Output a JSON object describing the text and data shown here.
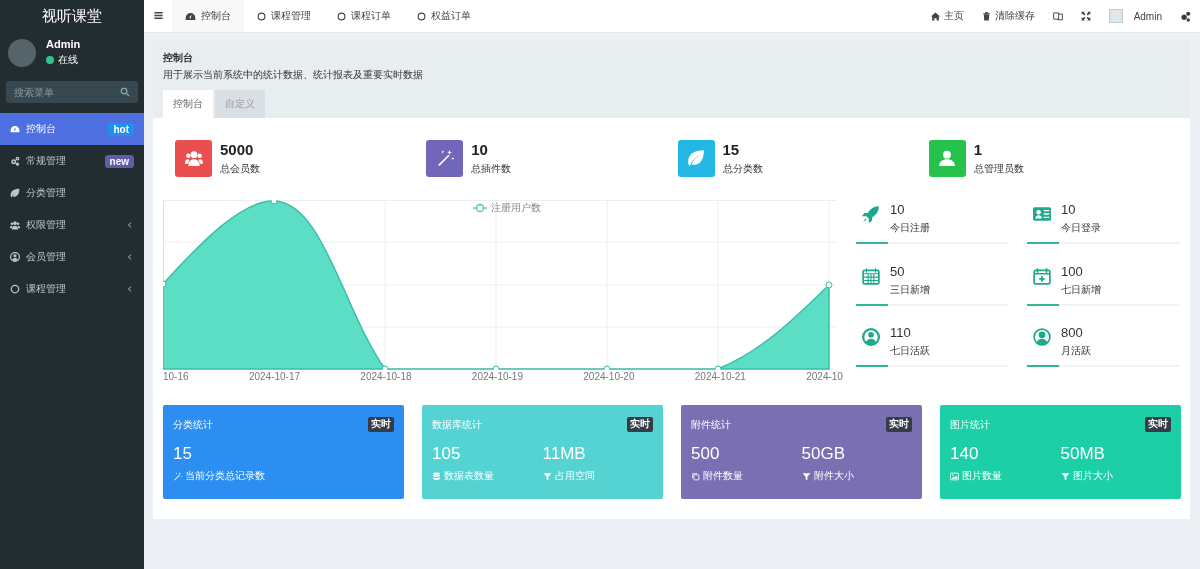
{
  "sidebar": {
    "logo": "视听课堂",
    "user": {
      "name": "Admin",
      "status": "在线"
    },
    "search": {
      "placeholder": "搜索菜单"
    },
    "items": [
      {
        "label": "控制台",
        "selected": true,
        "has_children": false,
        "badge": {
          "text": "hot",
          "color": "#1e90f0"
        }
      },
      {
        "label": "常规管理",
        "selected": false,
        "has_children": false,
        "badge": {
          "text": "new",
          "color": "#605ca8"
        }
      },
      {
        "label": "分类管理",
        "selected": false,
        "has_children": false
      },
      {
        "label": "权限管理",
        "selected": false,
        "has_children": true
      },
      {
        "label": "会员管理",
        "selected": false,
        "has_children": true
      },
      {
        "label": "课程管理",
        "selected": false,
        "has_children": true
      }
    ]
  },
  "topbar": {
    "tabs": [
      {
        "label": "控制台",
        "selected": true
      },
      {
        "label": "课程管理",
        "selected": false
      },
      {
        "label": "课程订单",
        "selected": false
      },
      {
        "label": "权益订单",
        "selected": false
      }
    ],
    "links": [
      "主页",
      "清除缓存"
    ],
    "user": "Admin"
  },
  "panel": {
    "title": "控制台",
    "description": "用于展示当前系统中的统计数据、统计报表及重要实时数据",
    "tabs": [
      {
        "label": "控制台",
        "selected": true
      },
      {
        "label": "自定义",
        "selected": false
      }
    ],
    "stats": [
      {
        "value": "5000",
        "label": "总会员数",
        "color": "#e94f4f"
      },
      {
        "value": "10",
        "label": "总插件数",
        "color": "#7266ba"
      },
      {
        "value": "15",
        "label": "总分类数",
        "color": "#23b7e5"
      },
      {
        "value": "1",
        "label": "总管理员数",
        "color": "#27c24c"
      }
    ],
    "chart": {
      "legend": "注册用户数",
      "x_labels": [
        "10-16",
        "2024-10-17",
        "2024-10-18",
        "2024-10-19",
        "2024-10-20",
        "2024-10-21",
        "2024-10"
      ]
    },
    "mini_stats": [
      {
        "value": "10",
        "label": "今日注册"
      },
      {
        "value": "10",
        "label": "今日登录"
      },
      {
        "value": "50",
        "label": "三日新增"
      },
      {
        "value": "100",
        "label": "七日新增"
      },
      {
        "value": "110",
        "label": "七日活跃"
      },
      {
        "value": "800",
        "label": "月活跃"
      }
    ],
    "cards": [
      {
        "title": "分类统计",
        "badge": "实时",
        "color": "#2b8ef0",
        "metrics": [
          {
            "value": "15",
            "label": "当前分类总记录数"
          }
        ]
      },
      {
        "title": "数据库统计",
        "badge": "实时",
        "color": "#55d3d3",
        "metrics": [
          {
            "value": "105",
            "label": "数据表数量"
          },
          {
            "value": "11MB",
            "label": "占用空间"
          }
        ]
      },
      {
        "title": "附件统计",
        "badge": "实时",
        "color": "#7a6fb3",
        "metrics": [
          {
            "value": "500",
            "label": "附件数量"
          },
          {
            "value": "50GB",
            "label": "附件大小"
          }
        ]
      },
      {
        "title": "图片统计",
        "badge": "实时",
        "color": "#1dcfa6",
        "metrics": [
          {
            "value": "140",
            "label": "图片数量"
          },
          {
            "value": "50MB",
            "label": "图片大小"
          }
        ]
      }
    ]
  }
}
